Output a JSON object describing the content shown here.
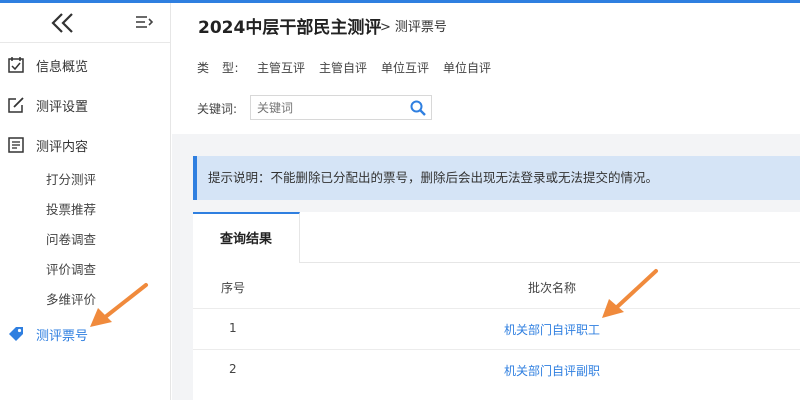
{
  "sidebar": {
    "items": [
      {
        "label": "信息概览",
        "icon": "calendar-check-icon"
      },
      {
        "label": "测评设置",
        "icon": "edit-icon"
      },
      {
        "label": "测评内容",
        "icon": "list-icon"
      }
    ],
    "sub_items": [
      "打分测评",
      "投票推荐",
      "问卷调查",
      "评价调查",
      "多维评价"
    ],
    "active": {
      "label": "测评票号",
      "icon": "tag-icon"
    }
  },
  "header": {
    "title": "2024中层干部民主测评",
    "breadcrumb_sep": ">",
    "breadcrumb": "测评票号",
    "type_label": "类　型:",
    "type_options": [
      "主管互评",
      "主管自评",
      "单位互评",
      "单位自评"
    ],
    "keyword_label": "关键词:",
    "keyword_placeholder": "关键词"
  },
  "tip": "提示说明：不能删除已分配出的票号，删除后会出现无法登录或无法提交的情况。",
  "results": {
    "tab": "查询结果",
    "columns": [
      "序号",
      "批次名称"
    ],
    "rows": [
      {
        "num": "1",
        "name": "机关部门自评职工"
      },
      {
        "num": "2",
        "name": "机关部门自评副职"
      }
    ]
  },
  "colors": {
    "accent": "#2f7fe0",
    "annotation_arrow": "#f08a3c"
  }
}
